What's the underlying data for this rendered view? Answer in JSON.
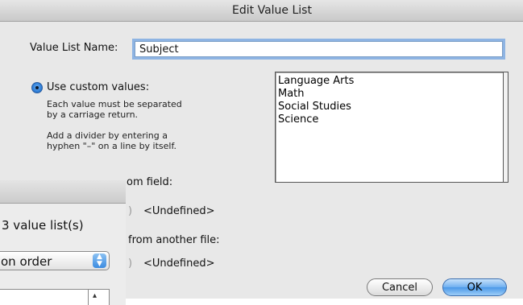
{
  "dialog": {
    "title": "Edit Value List",
    "name_label": "Value List Name:",
    "name_value": "Subject",
    "custom_values_label": "Use custom values:",
    "custom_hint_1": "Each value must be separated",
    "custom_hint_2": "by a carriage return.",
    "divider_hint_1": "Add a divider by entering a",
    "divider_hint_2": "hyphen \"–\" on a line by itself.",
    "from_field_label_partial": "om field:",
    "undefined_1": "<Undefined>",
    "from_file_label_partial": "from another file:",
    "undefined_2": "<Undefined>",
    "custom_values": [
      "Language Arts",
      "Math",
      "Social Studies",
      "Science"
    ],
    "cancel_label": "Cancel",
    "ok_label": "OK"
  },
  "background_window": {
    "count_text": "3 value list(s)",
    "sort_popup_partial": "on order",
    "popup_arrows": "▲▼"
  },
  "icons": {
    "radio_selected": "radio-selected-icon",
    "radio_unselected": "radio-unselected-icon",
    "popup_arrows": "up-down-arrows-icon"
  },
  "colors": {
    "focus_ring": "#8eb4e3",
    "default_button": "#6fb0f0",
    "radio_selected": "#2f7fd8"
  }
}
